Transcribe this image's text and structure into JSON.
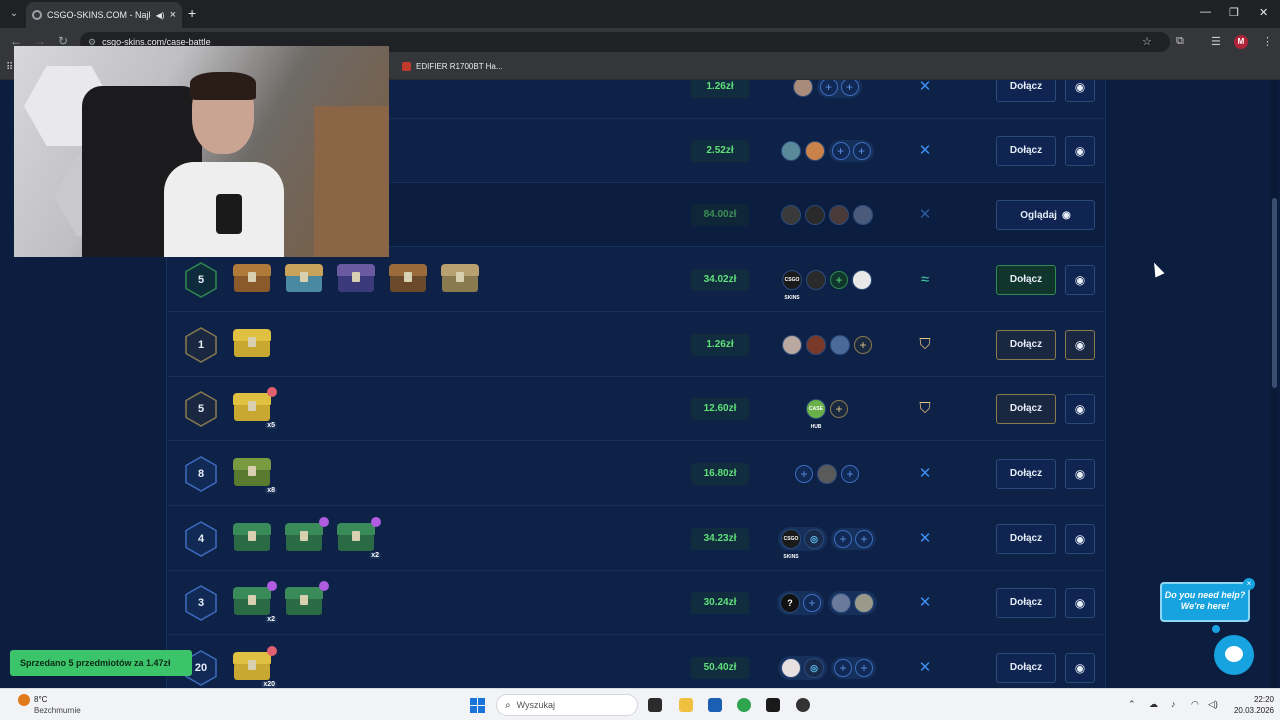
{
  "browser": {
    "tab_title": "CSGO-SKINS.COM - Najlep",
    "url": "csgo-skins.com/case-battle",
    "bookmark_label": "EDIFIER R1700BT Ha..."
  },
  "battles": [
    {
      "rounds": "",
      "price": "1.26zł",
      "price_faded": false,
      "mode": "swords",
      "action": "Dołącz"
    },
    {
      "rounds": "",
      "price": "2.52zł",
      "price_faded": false,
      "mode": "swords",
      "action": "Dołącz"
    },
    {
      "rounds": "",
      "price": "84.00zł",
      "price_faded": true,
      "mode": "swords",
      "action": "Oglądaj"
    },
    {
      "rounds": "5",
      "price": "34.02zł",
      "price_faded": false,
      "mode": "team",
      "action": "Dołącz"
    },
    {
      "rounds": "1",
      "price": "1.26zł",
      "price_faded": false,
      "mode": "shield",
      "action": "Dołącz"
    },
    {
      "rounds": "5",
      "price": "12.60zł",
      "price_faded": false,
      "mode": "shield",
      "action": "Dołącz",
      "case_mult": [
        "x5"
      ]
    },
    {
      "rounds": "8",
      "price": "16.80zł",
      "price_faded": false,
      "mode": "swords",
      "action": "Dołącz",
      "case_mult": [
        "x8"
      ]
    },
    {
      "rounds": "4",
      "price": "34.23zł",
      "price_faded": false,
      "mode": "swords",
      "action": "Dołącz",
      "case_mult": [
        "",
        "",
        "x2"
      ]
    },
    {
      "rounds": "3",
      "price": "30.24zł",
      "price_faded": false,
      "mode": "swords",
      "action": "Dołącz",
      "case_mult": [
        "x2",
        ""
      ]
    },
    {
      "rounds": "20",
      "price": "50.40zł",
      "price_faded": false,
      "mode": "swords",
      "action": "Dołącz",
      "case_mult": [
        "x20"
      ]
    }
  ],
  "avatar_text": {
    "question": "?",
    "logo": "CSGO SKINS",
    "hub": "CASE HUB"
  },
  "toast": "Sprzedano 5 przedmiotów za 1.47zł",
  "help": {
    "bubble": "Do you need help? We're here!",
    "close": "×"
  },
  "taskbar": {
    "weather_temp": "8°C",
    "weather_desc": "Bezchmurnie",
    "search_placeholder": "Wyszukaj",
    "time": "22:20",
    "date": "20.03.2026"
  },
  "colors": {
    "page_bg": "#0b1e3f",
    "panel_bg": "#0e2247",
    "price_green": "#5fe07a",
    "swords_blue": "#3f8ef0",
    "shield_gold": "#e2c37a",
    "team_teal": "#46d7a8",
    "help_blue": "#16a3e0"
  }
}
